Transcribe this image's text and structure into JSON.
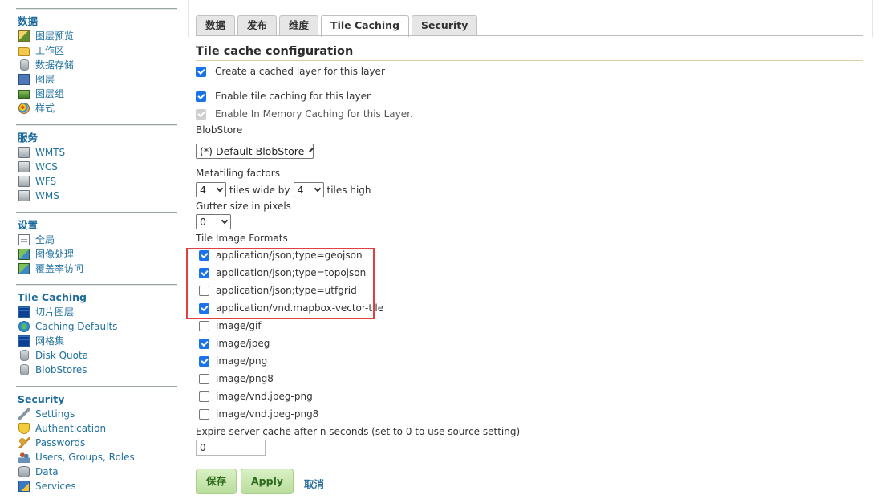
{
  "sidebar": {
    "sections": [
      {
        "title": "数据",
        "items": [
          {
            "label": "图层预览",
            "icon": "layer-preview-icon"
          },
          {
            "label": "工作区",
            "icon": "folder-icon"
          },
          {
            "label": "数据存储",
            "icon": "database-icon"
          },
          {
            "label": "图层",
            "icon": "layer-icon"
          },
          {
            "label": "图层组",
            "icon": "layer-group-icon"
          },
          {
            "label": "样式",
            "icon": "palette-icon"
          }
        ]
      },
      {
        "title": "服务",
        "items": [
          {
            "label": "WMTS",
            "icon": "service-icon"
          },
          {
            "label": "WCS",
            "icon": "service-icon"
          },
          {
            "label": "WFS",
            "icon": "service-icon"
          },
          {
            "label": "WMS",
            "icon": "service-icon"
          }
        ]
      },
      {
        "title": "设置",
        "items": [
          {
            "label": "全局",
            "icon": "global-settings-icon"
          },
          {
            "label": "图像处理",
            "icon": "image-processing-icon"
          },
          {
            "label": "覆盖率访问",
            "icon": "coverage-access-icon"
          }
        ]
      },
      {
        "title": "Tile Caching",
        "items": [
          {
            "label": "切片图层",
            "icon": "tile-layers-icon"
          },
          {
            "label": "Caching Defaults",
            "icon": "globe-icon"
          },
          {
            "label": "网格集",
            "icon": "gridset-icon"
          },
          {
            "label": "Disk Quota",
            "icon": "disk-quota-icon"
          },
          {
            "label": "BlobStores",
            "icon": "blobstore-icon"
          }
        ]
      },
      {
        "title": "Security",
        "items": [
          {
            "label": "Settings",
            "icon": "wrench-icon"
          },
          {
            "label": "Authentication",
            "icon": "shield-icon"
          },
          {
            "label": "Passwords",
            "icon": "key-icon"
          },
          {
            "label": "Users, Groups, Roles",
            "icon": "users-icon"
          },
          {
            "label": "Data",
            "icon": "data-icon"
          },
          {
            "label": "Services",
            "icon": "services-icon"
          }
        ]
      }
    ]
  },
  "tabs": [
    {
      "label": "数据",
      "active": false
    },
    {
      "label": "发布",
      "active": false
    },
    {
      "label": "维度",
      "active": false
    },
    {
      "label": "Tile Caching",
      "active": true
    },
    {
      "label": "Security",
      "active": false
    }
  ],
  "config": {
    "title": "Tile cache configuration",
    "create_cached_layer": {
      "label": "Create a cached layer for this layer",
      "checked": true
    },
    "enable_tile_caching": {
      "label": "Enable tile caching for this layer",
      "checked": true
    },
    "enable_in_memory": {
      "label": "Enable In Memory Caching for this Layer.",
      "checked": true,
      "disabled": true
    },
    "blobstore_label": "BlobStore",
    "blobstore_value": "(*) Default BlobStore",
    "metatiling_label": "Metatiling factors",
    "metatile_wide": "4",
    "tiles_wide_by": "tiles wide by",
    "metatile_high": "4",
    "tiles_high": "tiles high",
    "gutter_label": "Gutter size in pixels",
    "gutter_value": "0",
    "formats_label": "Tile Image Formats",
    "formats": [
      {
        "label": "application/json;type=geojson",
        "checked": true
      },
      {
        "label": "application/json;type=topojson",
        "checked": true
      },
      {
        "label": "application/json;type=utfgrid",
        "checked": false
      },
      {
        "label": "application/vnd.mapbox-vector-tile",
        "checked": true
      },
      {
        "label": "image/gif",
        "checked": false
      },
      {
        "label": "image/jpeg",
        "checked": true
      },
      {
        "label": "image/png",
        "checked": true
      },
      {
        "label": "image/png8",
        "checked": false
      },
      {
        "label": "image/vnd.jpeg-png",
        "checked": false
      },
      {
        "label": "image/vnd.jpeg-png8",
        "checked": false
      }
    ],
    "expire_label": "Expire server cache after n seconds (set to 0 to use source setting)",
    "expire_value": "0"
  },
  "buttons": {
    "save": "保存",
    "apply": "Apply",
    "cancel": "取消"
  },
  "colors": {
    "highlight": "#e04040",
    "link": "#22729e",
    "button_bg": "#c8e6ae"
  }
}
